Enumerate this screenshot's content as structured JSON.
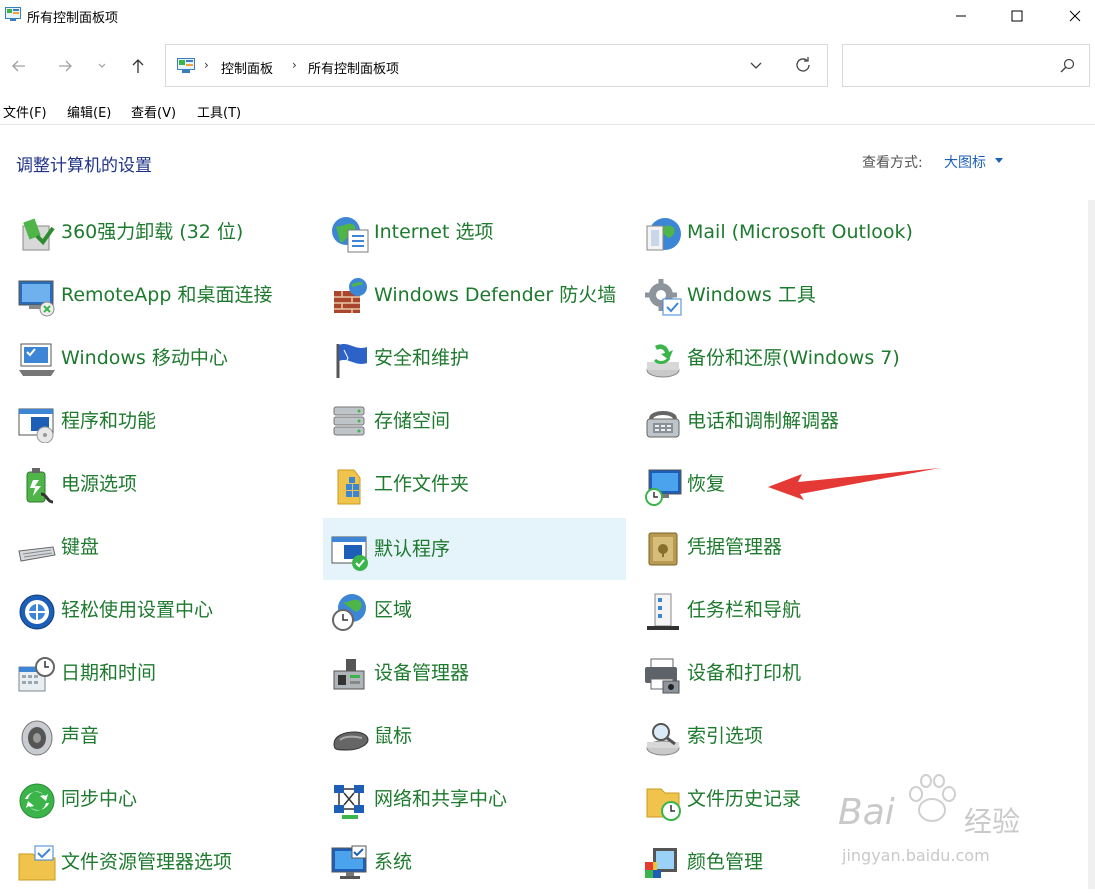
{
  "window": {
    "title": "所有控制面板项"
  },
  "address": {
    "crumbs": [
      "控制面板",
      "所有控制面板项"
    ]
  },
  "search": {
    "placeholder": ""
  },
  "menu": [
    "文件(F)",
    "编辑(E)",
    "查看(V)",
    "工具(T)"
  ],
  "header": {
    "title": "调整计算机的设置",
    "view_by_label": "查看方式:",
    "view_by_value": "大图标"
  },
  "items": [
    {
      "label": "360强力卸载 (32 位)",
      "icon": "uninstall-icon"
    },
    {
      "label": "Internet 选项",
      "icon": "internet-options-icon"
    },
    {
      "label": "Mail (Microsoft Outlook)",
      "icon": "mail-icon"
    },
    {
      "label": "RemoteApp 和桌面连接",
      "icon": "remote-desktop-icon"
    },
    {
      "label": "Windows Defender 防火墙",
      "icon": "firewall-icon"
    },
    {
      "label": "Windows 工具",
      "icon": "windows-tools-icon"
    },
    {
      "label": "Windows 移动中心",
      "icon": "mobility-center-icon"
    },
    {
      "label": "安全和维护",
      "icon": "security-flag-icon"
    },
    {
      "label": "备份和还原(Windows 7)",
      "icon": "backup-icon"
    },
    {
      "label": "程序和功能",
      "icon": "programs-icon"
    },
    {
      "label": "存储空间",
      "icon": "storage-icon"
    },
    {
      "label": "电话和调制解调器",
      "icon": "phone-modem-icon"
    },
    {
      "label": "电源选项",
      "icon": "power-icon"
    },
    {
      "label": "工作文件夹",
      "icon": "work-folders-icon"
    },
    {
      "label": "恢复",
      "icon": "recovery-icon"
    },
    {
      "label": "键盘",
      "icon": "keyboard-icon"
    },
    {
      "label": "默认程序",
      "icon": "default-programs-icon"
    },
    {
      "label": "凭据管理器",
      "icon": "credential-vault-icon"
    },
    {
      "label": "轻松使用设置中心",
      "icon": "ease-of-access-icon"
    },
    {
      "label": "区域",
      "icon": "region-icon"
    },
    {
      "label": "任务栏和导航",
      "icon": "taskbar-icon"
    },
    {
      "label": "日期和时间",
      "icon": "date-time-icon"
    },
    {
      "label": "设备管理器",
      "icon": "device-manager-icon"
    },
    {
      "label": "设备和打印机",
      "icon": "printer-icon"
    },
    {
      "label": "声音",
      "icon": "speaker-icon"
    },
    {
      "label": "鼠标",
      "icon": "mouse-icon"
    },
    {
      "label": "索引选项",
      "icon": "indexing-icon"
    },
    {
      "label": "同步中心",
      "icon": "sync-icon"
    },
    {
      "label": "网络和共享中心",
      "icon": "network-icon"
    },
    {
      "label": "文件历史记录",
      "icon": "file-history-icon"
    },
    {
      "label": "文件资源管理器选项",
      "icon": "folder-options-icon"
    },
    {
      "label": "系统",
      "icon": "system-icon"
    },
    {
      "label": "颜色管理",
      "icon": "color-management-icon"
    }
  ],
  "selected_item": "默认程序",
  "colors": {
    "item_text": "#1e7a2e",
    "heading": "#1e3287",
    "link": "#1d5fb6",
    "selection": "#e5f3fb",
    "annotation_arrow": "#e53935"
  },
  "watermark": {
    "brand": "Bai",
    "brand_cn": "经验",
    "url": "jingyan.baidu.com"
  }
}
